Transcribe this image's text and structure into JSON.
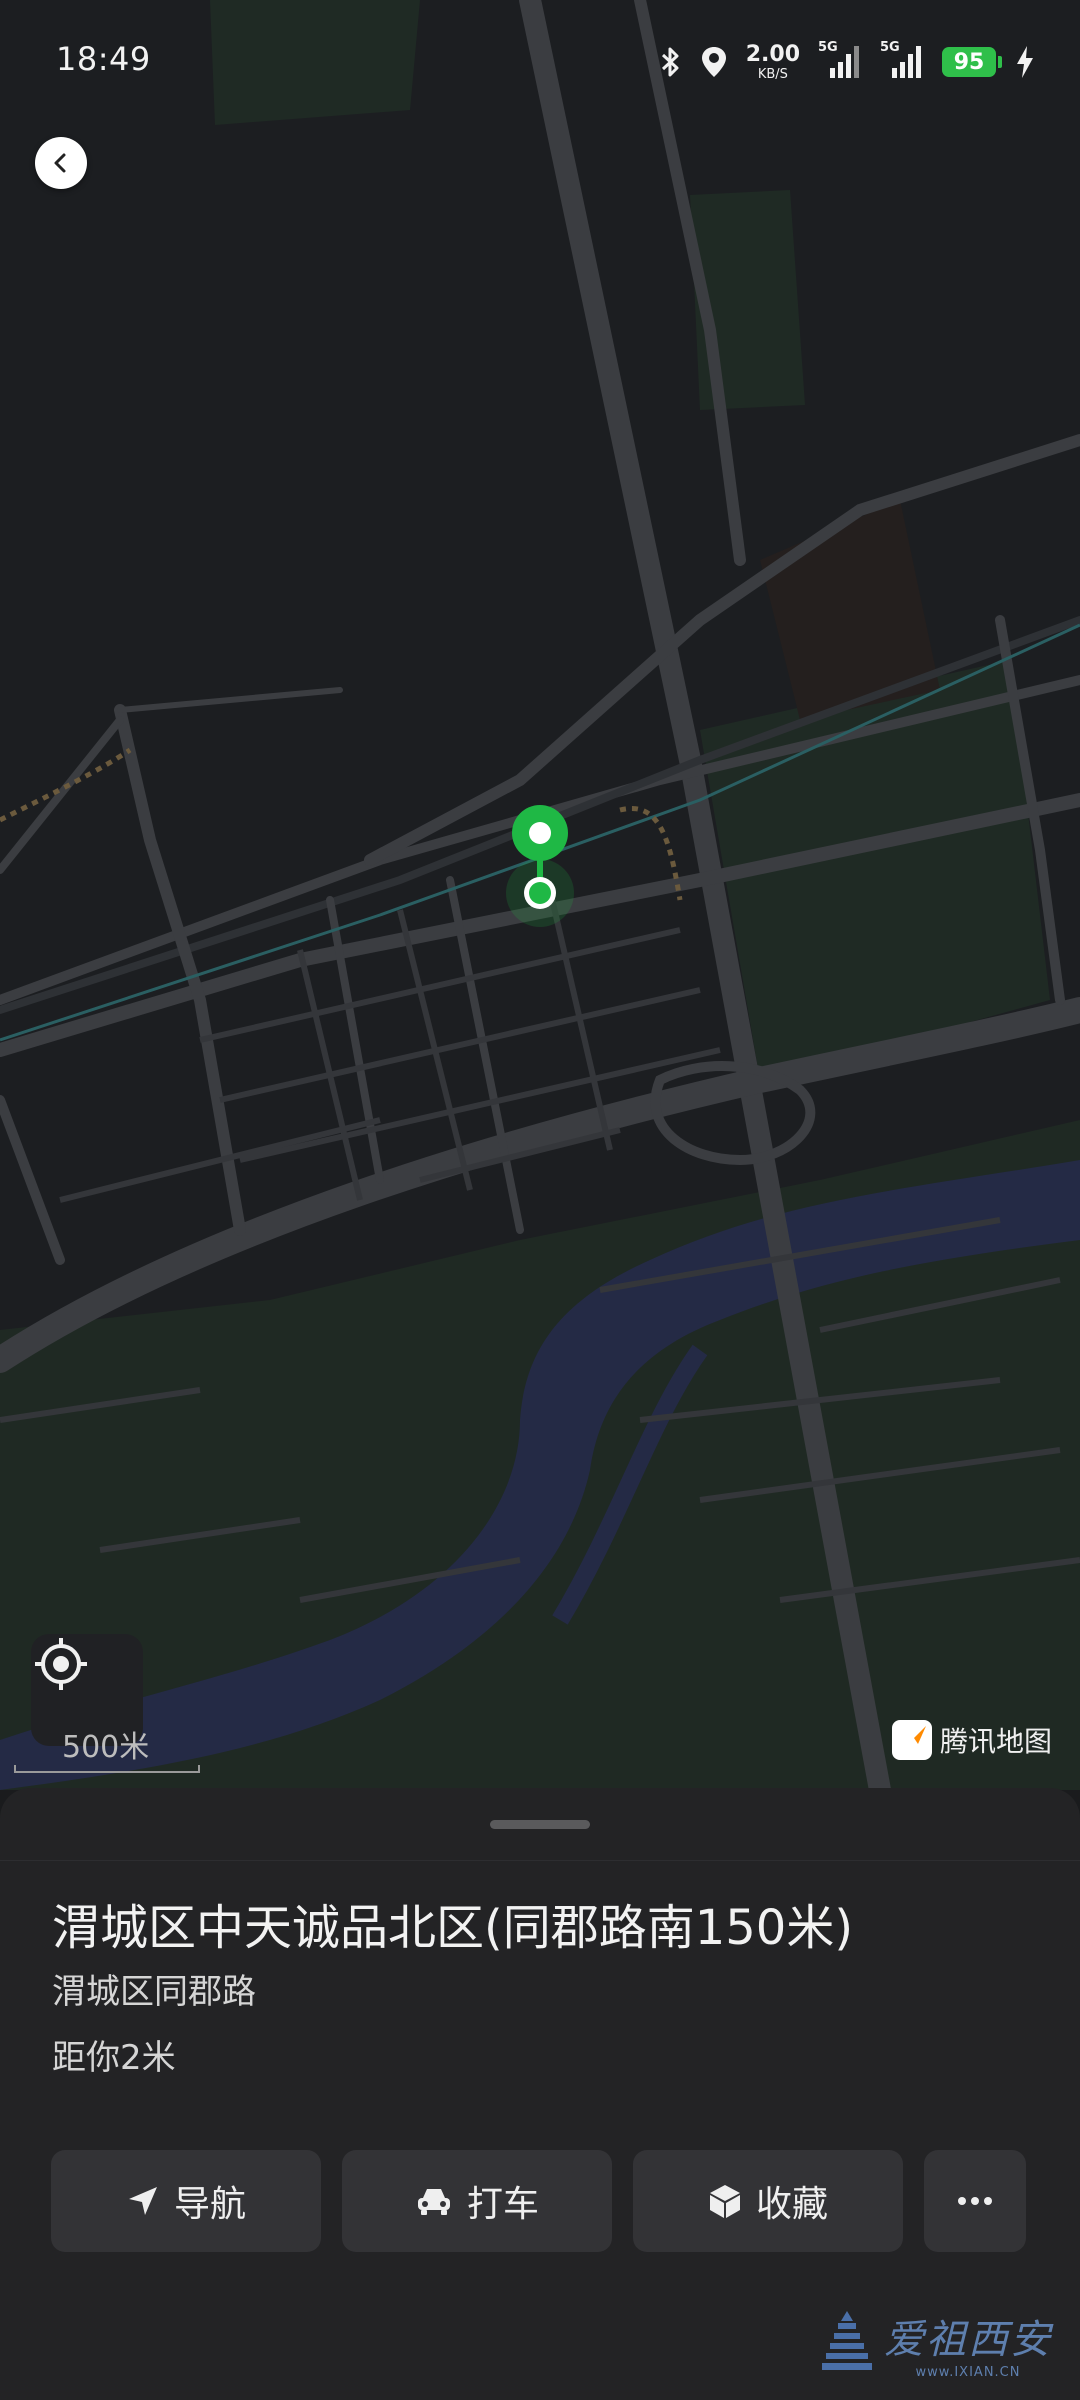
{
  "status_bar": {
    "time": "18:49",
    "net_speed_value": "2.00",
    "net_speed_unit": "KB/S",
    "sim1_label": "5G",
    "sim2_label": "5G",
    "battery_level": "95",
    "icons": [
      "bluetooth-icon",
      "location-icon",
      "signal-icon",
      "charging-icon"
    ]
  },
  "map": {
    "scale_label": "500米",
    "provider_name": "腾讯地图"
  },
  "place": {
    "title": "渭城区中天诚品北区(同郡路南150米)",
    "address": "渭城区同郡路",
    "distance": "距你2米"
  },
  "actions": [
    {
      "label": "导航",
      "icon": "navigation-arrow-icon"
    },
    {
      "label": "打车",
      "icon": "taxi-icon"
    },
    {
      "label": "收藏",
      "icon": "favorite-box-icon"
    },
    {
      "label": "",
      "icon": "more-dots-icon"
    }
  ],
  "watermark": {
    "text": "爱祖西安",
    "domain": "www.IXIAN.CN"
  },
  "colors": {
    "map_background": "#1c1e21",
    "pin_green": "#1fb845",
    "river": "#242a45",
    "park": "#1f2a24",
    "sheet": "#232325",
    "button": "#333336"
  }
}
